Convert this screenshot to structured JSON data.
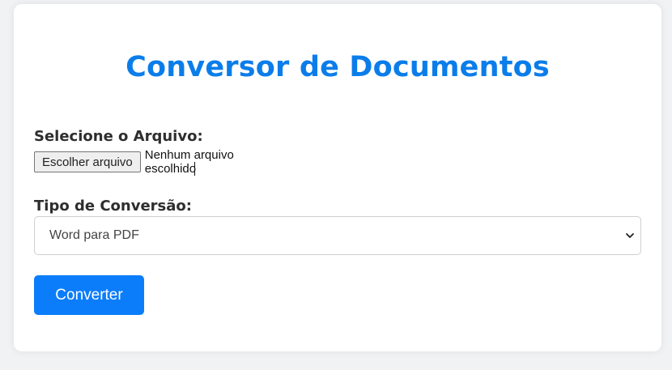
{
  "page": {
    "title": "Conversor de Documentos"
  },
  "file": {
    "label": "Selecione o Arquivo:",
    "button_label": "Escolher arquivo",
    "status": "Nenhum arquivo escolhido"
  },
  "conversion": {
    "label": "Tipo de Conversão:",
    "selected": "Word para PDF",
    "icon": "chevron-down-icon"
  },
  "actions": {
    "convert_label": "Converter"
  },
  "colors": {
    "accent": "#0b7dfb",
    "title": "#0b7dea",
    "background": "#f1f2f4"
  }
}
